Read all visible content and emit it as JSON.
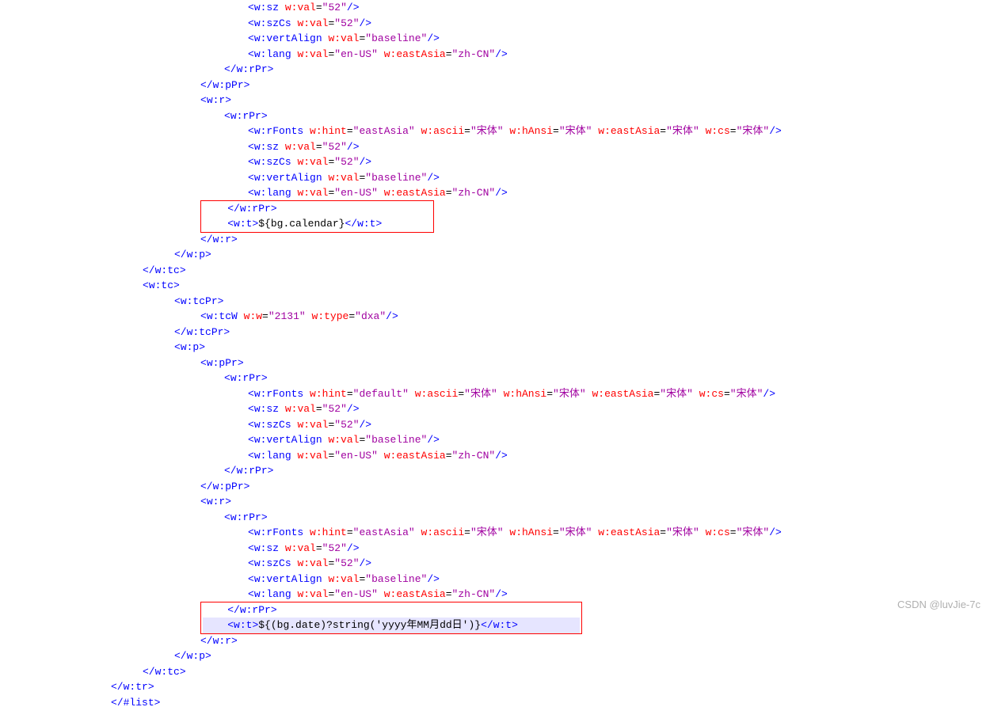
{
  "watermark": "CSDN @luvJie-7c",
  "fonts": {
    "cjk": "宋体"
  },
  "vals": {
    "sz": "52",
    "baseline": "baseline",
    "enUS": "en-US",
    "zhCN": "zh-CN",
    "eastAsia": "eastAsia",
    "defaultHint": "default",
    "tcW_w": "2131",
    "tcW_type": "dxa"
  },
  "expr": {
    "calendar": "${bg.calendar}",
    "date": "${(bg.date)?string('yyyy年MM月dd日')}"
  },
  "tags": {
    "wsz": "w:sz",
    "wszCs": "w:szCs",
    "wvertAlign": "w:vertAlign",
    "wlang": "w:lang",
    "wrPr": "w:rPr",
    "wpPr": "w:pPr",
    "wr": "w:r",
    "wrFonts": "w:rFonts",
    "wt": "w:t",
    "wp": "w:p",
    "wtc": "w:tc",
    "wtcPr": "w:tcPr",
    "wtcW": "w:tcW",
    "wtr": "w:tr",
    "listEnd": "/#list"
  },
  "attrs": {
    "wval": "w:val",
    "whint": "w:hint",
    "wascii": "w:ascii",
    "whAnsi": "w:hAnsi",
    "weastAsia": "w:eastAsia",
    "wcs": "w:cs",
    "ww": "w:w",
    "wtype": "w:type"
  }
}
